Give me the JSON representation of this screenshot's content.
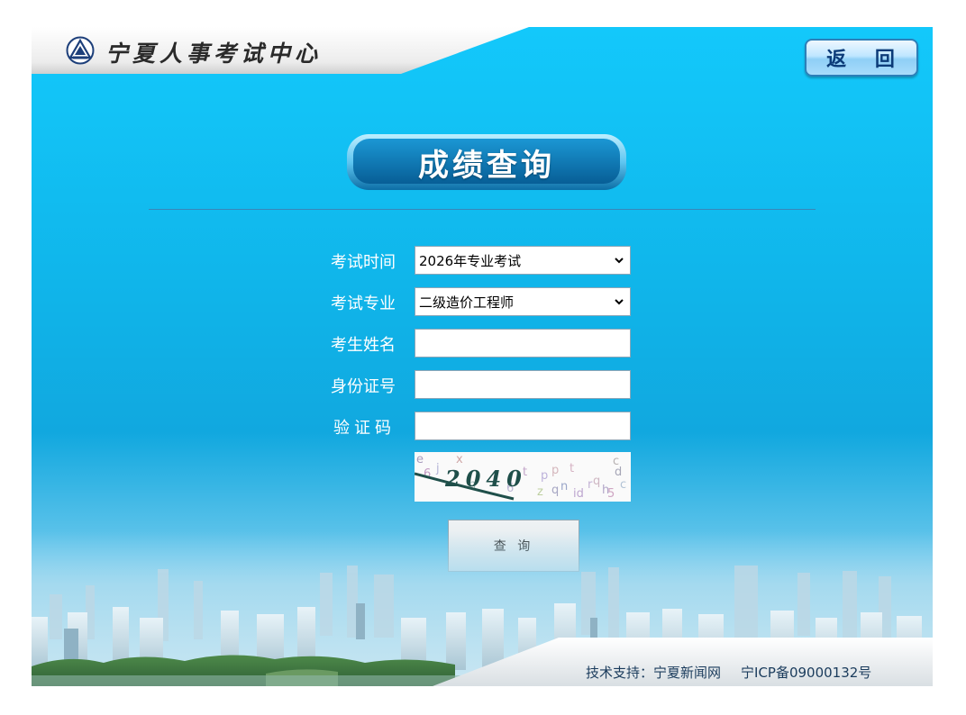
{
  "header": {
    "site_title": "宁夏人事考试中心",
    "back_label": "返 回"
  },
  "main": {
    "page_title": "成绩查询",
    "form": {
      "exam_time_label": "考试时间",
      "exam_time_value": "2026年专业考试",
      "exam_major_label": "考试专业",
      "exam_major_value": "二级造价工程师",
      "name_label": "考生姓名",
      "id_label": "身份证号",
      "captcha_label": "验证码",
      "captcha_text": "2040",
      "query_label": "查 询"
    }
  },
  "footer": {
    "support": "技术支持：宁夏新闻网",
    "icp": "宁ICP备09000132号"
  },
  "colors": {
    "sky_blue": "#12c3f6",
    "title_badge": "#0a7ab8",
    "back_text": "#0b3b78"
  },
  "icons": [
    "emblem-logo-icon",
    "chevron-down-icon"
  ]
}
